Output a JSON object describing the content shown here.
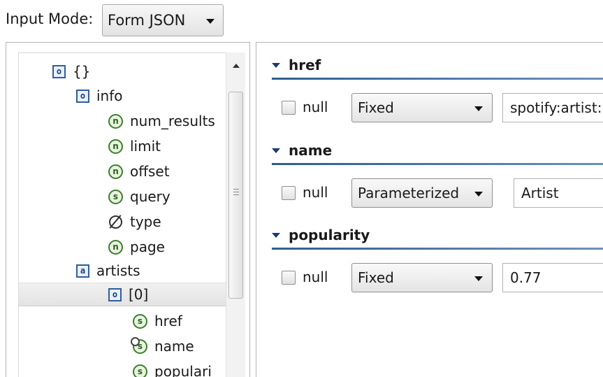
{
  "toolbar": {
    "input_mode_label": "Input Mode:",
    "input_mode_value": "Form JSON"
  },
  "tree": {
    "nodes": [
      {
        "label": "{}",
        "icon": "o",
        "icon_name": "object-icon"
      },
      {
        "label": "info",
        "icon": "o",
        "icon_name": "object-icon"
      },
      {
        "label": "num_results",
        "icon": "n",
        "icon_name": "number-icon"
      },
      {
        "label": "limit",
        "icon": "n",
        "icon_name": "number-icon"
      },
      {
        "label": "offset",
        "icon": "n",
        "icon_name": "number-icon"
      },
      {
        "label": "query",
        "icon": "s",
        "icon_name": "string-icon"
      },
      {
        "label": "type",
        "icon": "∅",
        "icon_name": "null-icon"
      },
      {
        "label": "page",
        "icon": "n",
        "icon_name": "number-icon"
      },
      {
        "label": "artists",
        "icon": "a",
        "icon_name": "array-icon"
      },
      {
        "label": "[0]",
        "icon": "o",
        "icon_name": "object-icon",
        "selected": true
      },
      {
        "label": "href",
        "icon": "s",
        "icon_name": "string-icon"
      },
      {
        "label": "name",
        "icon": "s",
        "icon_name": "parameterized-string-icon"
      },
      {
        "label": "populari",
        "icon": "s",
        "icon_name": "string-icon"
      }
    ]
  },
  "form": {
    "sections": [
      {
        "title": "href",
        "null_label": "null",
        "mode": "Fixed",
        "value": "spotify:artist:"
      },
      {
        "title": "name",
        "null_label": "null",
        "mode": "Parameterized",
        "value": "Artist"
      },
      {
        "title": "popularity",
        "null_label": "null",
        "mode": "Fixed",
        "value": "0.77"
      }
    ]
  }
}
